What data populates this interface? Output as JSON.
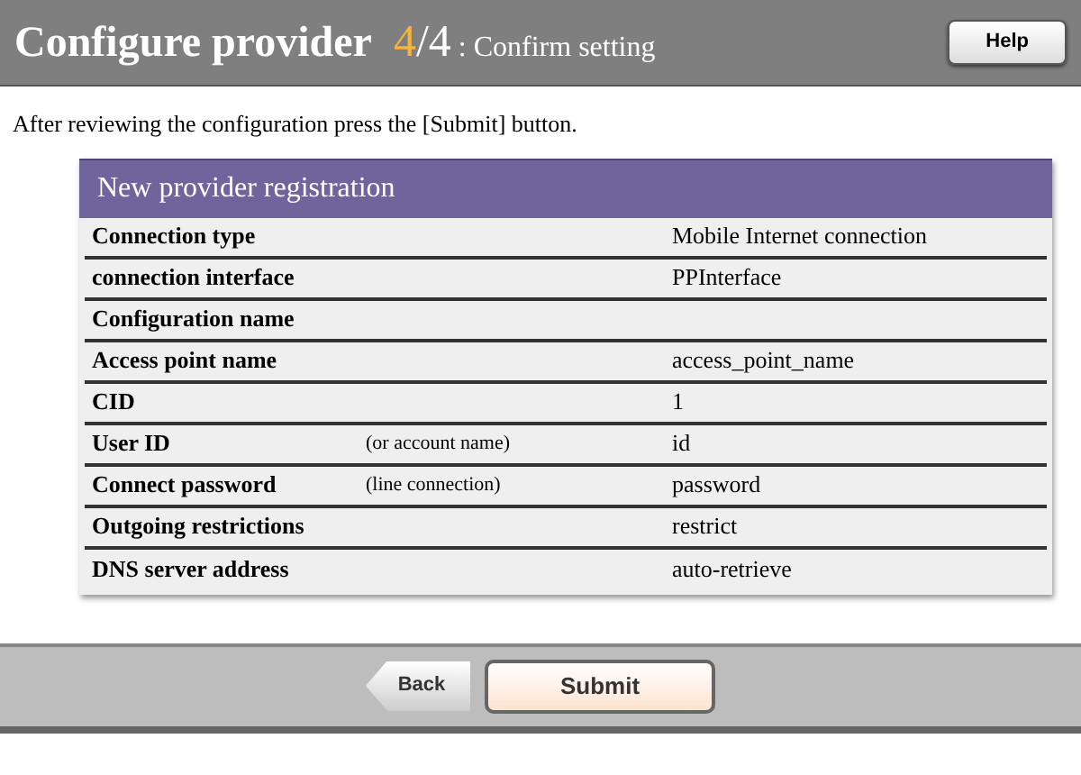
{
  "header": {
    "title": "Configure provider",
    "step": "4",
    "step_total": "/4",
    "subtitle": ": Confirm setting",
    "help_button": "Help"
  },
  "instruction": "After reviewing the configuration press the [Submit] button.",
  "panel": {
    "title": "New provider registration",
    "rows": [
      {
        "label": "Connection type",
        "value": "Mobile Internet connection"
      },
      {
        "label": "connection interface",
        "value": "PPInterface"
      },
      {
        "label": "Configuration name"
      },
      {
        "label": "Access point name",
        "value": "access_point_name"
      },
      {
        "label": "CID",
        "value": "1"
      },
      {
        "label": "User ID",
        "note": "(or account name)",
        "value": "id"
      },
      {
        "label": "Connect password",
        "note": "(line connection)",
        "value": "password"
      },
      {
        "label": "Outgoing restrictions",
        "value": "restrict"
      },
      {
        "label": "DNS server address",
        "value": "auto-retrieve"
      }
    ]
  },
  "footer": {
    "back_button": "Back",
    "submit_button": "Submit"
  }
}
